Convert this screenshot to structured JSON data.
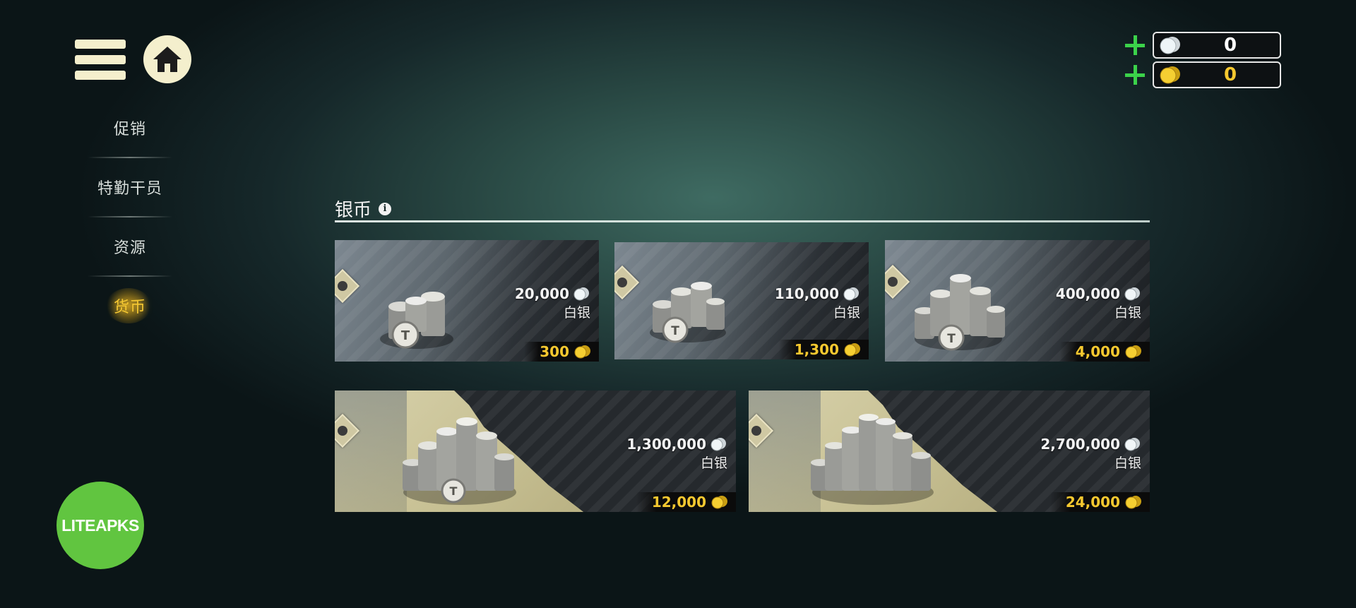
{
  "sidebar": {
    "items": [
      {
        "label": "促销"
      },
      {
        "label": "特勤干员"
      },
      {
        "label": "资源"
      },
      {
        "label": "货币",
        "active": true
      }
    ]
  },
  "wallet": {
    "silver": {
      "value": "0",
      "icon": "silver-coin-icon"
    },
    "gold": {
      "value": "0",
      "icon": "gold-coin-icon"
    }
  },
  "section": {
    "title": "银币"
  },
  "offers": [
    {
      "amount": "20,000",
      "unit": "白银",
      "price": "300"
    },
    {
      "amount": "110,000",
      "unit": "白银",
      "price": "1,300"
    },
    {
      "amount": "400,000",
      "unit": "白银",
      "price": "4,000"
    },
    {
      "amount": "1,300,000",
      "unit": "白银",
      "price": "12,000"
    },
    {
      "amount": "2,700,000",
      "unit": "白银",
      "price": "24,000"
    }
  ],
  "watermark": {
    "text": "LITEAPKS"
  },
  "colors": {
    "accent_gold": "#f5c82f",
    "plus_green": "#3bd24a",
    "menu_cream": "#f4efcd",
    "badge_green": "#61c540"
  }
}
